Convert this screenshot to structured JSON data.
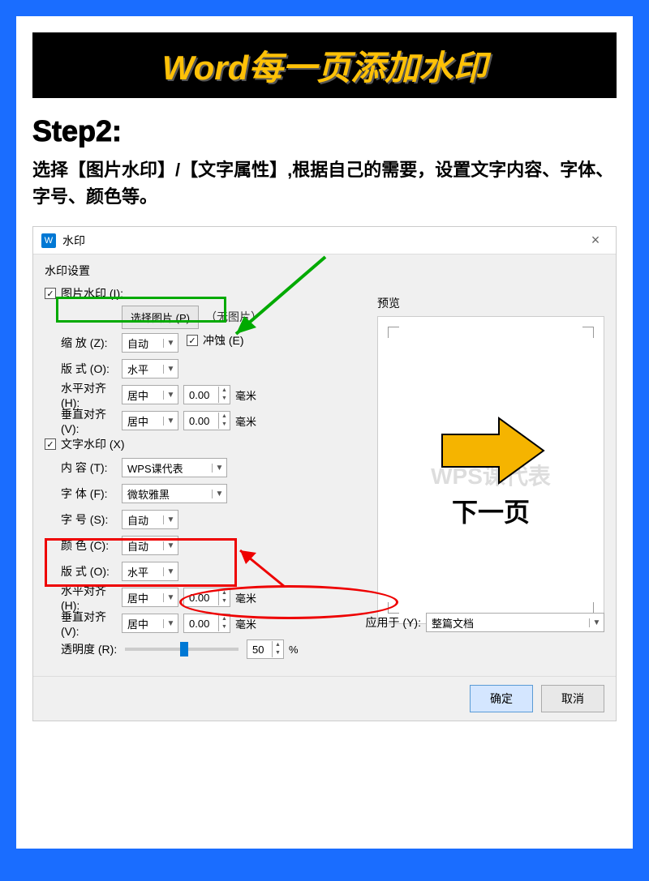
{
  "banner": {
    "title": "Word每一页添加水印"
  },
  "step": {
    "label": "Step2:",
    "desc": "选择【图片水印】/【文字属性】,根据自己的需要，设置文字内容、字体、字号、颜色等。"
  },
  "dialog": {
    "title": "水印",
    "section": "水印设置",
    "picWatermark": {
      "label": "图片水印 (I):",
      "selectBtn": "选择图片 (P)",
      "noImg": "（无图片）"
    },
    "zoom": {
      "label": "缩  放 (Z):",
      "value": "自动"
    },
    "erode": {
      "label": "冲蚀 (E)"
    },
    "layout1": {
      "label": "版  式 (O):",
      "value": "水平"
    },
    "hAlign1": {
      "label": "水平对齐 (H):",
      "value": "居中",
      "offset": "0.00",
      "unit": "毫米"
    },
    "vAlign1": {
      "label": "垂直对齐 (V):",
      "value": "居中",
      "offset": "0.00",
      "unit": "毫米"
    },
    "textWatermark": {
      "label": "文字水印 (X)"
    },
    "content": {
      "label": "内  容 (T):",
      "value": "WPS课代表"
    },
    "font": {
      "label": "字  体 (F):",
      "value": "微软雅黑"
    },
    "size": {
      "label": "字  号 (S):",
      "value": "自动"
    },
    "color": {
      "label": "颜  色 (C):",
      "value": "自动"
    },
    "layout2": {
      "label": "版  式 (O):",
      "value": "水平"
    },
    "hAlign2": {
      "label": "水平对齐 (H):",
      "value": "居中",
      "offset": "0.00",
      "unit": "毫米"
    },
    "vAlign2": {
      "label": "垂直对齐 (V):",
      "value": "居中",
      "offset": "0.00",
      "unit": "毫米"
    },
    "opacity": {
      "label": "透明度 (R):",
      "value": "50",
      "unit": "%"
    },
    "preview": {
      "label": "预览",
      "watermarkText": "WPS课代表",
      "nextPage": "下一页"
    },
    "applyTo": {
      "label": "应用于 (Y):",
      "value": "整篇文档"
    },
    "buttons": {
      "ok": "确定",
      "cancel": "取消"
    }
  }
}
